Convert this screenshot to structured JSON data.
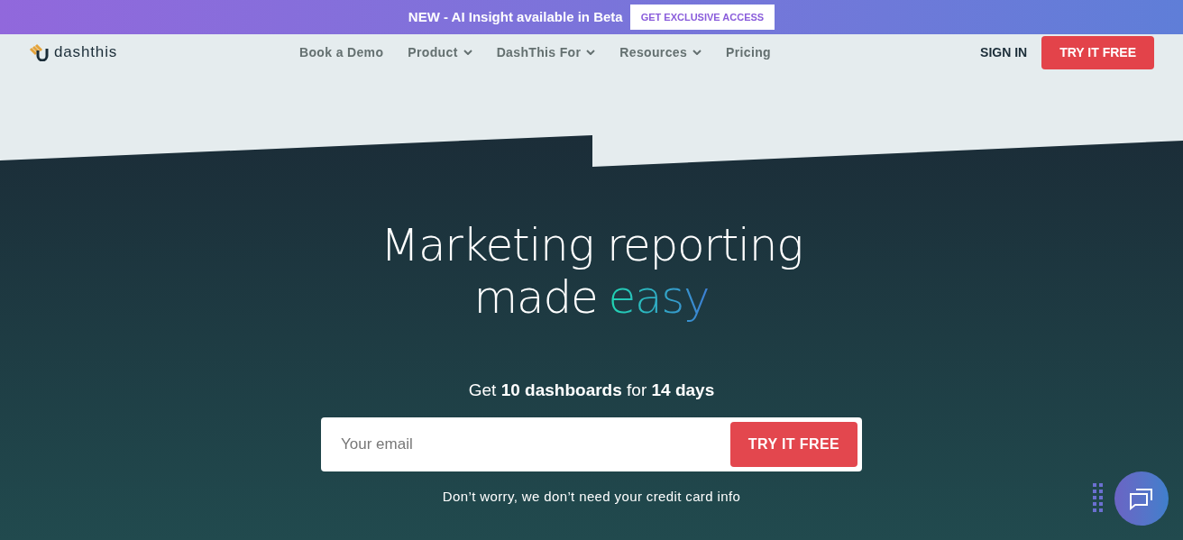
{
  "banner": {
    "text": "NEW - AI Insight available in Beta",
    "button": "GET EXCLUSIVE ACCESS"
  },
  "nav": {
    "logo": "dashthis",
    "items": [
      {
        "label": "Book a Demo",
        "dropdown": false
      },
      {
        "label": "Product",
        "dropdown": true
      },
      {
        "label": "DashThis For",
        "dropdown": true
      },
      {
        "label": "Resources",
        "dropdown": true
      },
      {
        "label": "Pricing",
        "dropdown": false
      }
    ],
    "sign_in": "SIGN IN",
    "cta": "TRY IT FREE"
  },
  "hero": {
    "headline": "Marketing reporting",
    "headline_prefix": "made",
    "headline_highlight": "easy",
    "subtitle": "Get **10 dashboards** for **14 days**",
    "email": {
      "placeholder": "Your email"
    },
    "submit": "TRY IT FREE",
    "note": "Don’t worry, we don’t need your credit card info"
  }
}
